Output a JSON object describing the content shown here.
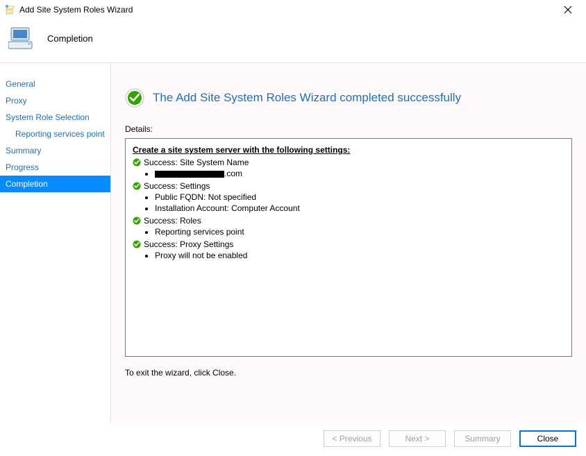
{
  "title_bar": {
    "title": "Add Site System Roles Wizard"
  },
  "header": {
    "page_title": "Completion"
  },
  "sidebar": {
    "steps": [
      {
        "label": "General"
      },
      {
        "label": "Proxy"
      },
      {
        "label": "System Role Selection"
      },
      {
        "label": "Reporting services point"
      },
      {
        "label": "Summary"
      },
      {
        "label": "Progress"
      },
      {
        "label": "Completion"
      }
    ]
  },
  "main": {
    "completion_message": "The Add Site System Roles Wizard completed successfully",
    "details_label": "Details:",
    "details": {
      "heading": "Create a site system server with the following settings:",
      "section1": {
        "title": "Success: Site System Name",
        "server_suffix": ".com"
      },
      "section2": {
        "title": "Success: Settings",
        "bullet1": "Public FQDN: Not specified",
        "bullet2": "Installation Account: Computer Account"
      },
      "section3": {
        "title": "Success: Roles",
        "bullet1": "Reporting services point"
      },
      "section4": {
        "title": "Success: Proxy Settings",
        "bullet1": "Proxy will not be enabled"
      }
    },
    "exit_hint": "To exit the wizard, click Close."
  },
  "footer": {
    "previous": "< Previous",
    "next": "Next >",
    "summary": "Summary",
    "close": "Close"
  }
}
